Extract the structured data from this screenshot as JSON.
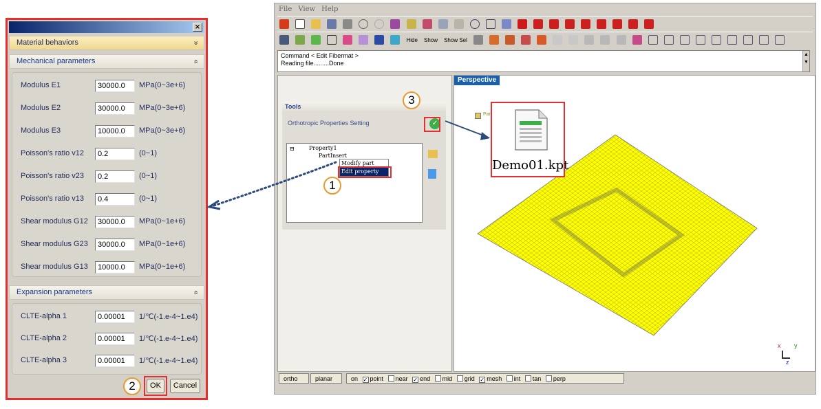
{
  "dialog": {
    "material_header": "Material behaviors",
    "mechanical_header": "Mechanical parameters",
    "expansion_header": "Expansion parameters",
    "close_glyph": "×",
    "chevron_double_down": "»",
    "chevron_double_up": "«",
    "mechanical": [
      {
        "label": "Modulus E1",
        "value": "30000.0",
        "unit": "MPa(0~3e+6)"
      },
      {
        "label": "Modulus E2",
        "value": "30000.0",
        "unit": "MPa(0~3e+6)"
      },
      {
        "label": "Modulus E3",
        "value": "10000.0",
        "unit": "MPa(0~3e+6)"
      },
      {
        "label": "Poisson's ratio v12",
        "value": "0.2",
        "unit": "(0~1)"
      },
      {
        "label": "Poisson's ratio v23",
        "value": "0.2",
        "unit": "(0~1)"
      },
      {
        "label": "Poisson's ratio v13",
        "value": "0.4",
        "unit": "(0~1)"
      },
      {
        "label": "Shear modulus G12",
        "value": "30000.0",
        "unit": "MPa(0~1e+6)"
      },
      {
        "label": "Shear modulus G23",
        "value": "30000.0",
        "unit": "MPa(0~1e+6)"
      },
      {
        "label": "Shear modulus G13",
        "value": "10000.0",
        "unit": "MPa(0~1e+6)"
      }
    ],
    "expansion": [
      {
        "label": "CLTE-alpha 1",
        "value": "0.00001",
        "unit": "1/℃(-1.e-4~1.e4)"
      },
      {
        "label": "CLTE-alpha 2",
        "value": "0.00001",
        "unit": "1/℃(-1.e-4~1.e4)"
      },
      {
        "label": "CLTE-alpha 3",
        "value": "0.00001",
        "unit": "1/℃(-1.e-4~1.e4)"
      }
    ],
    "ok_label": "OK",
    "cancel_label": "Cancel"
  },
  "badges": {
    "one": "1",
    "two": "2",
    "three": "3"
  },
  "app": {
    "menu": [
      "File",
      "View",
      "Help"
    ],
    "toolbar_text": {
      "hide": "Hide",
      "show": "Show",
      "show_sel": "Show Sel"
    },
    "command_lines": [
      "Command < Edit Fibermat >",
      "Reading file.........Done"
    ],
    "tools_title": "Tools",
    "tools_label": "Orthotropic Properties Setting",
    "tree_root": "Property1",
    "tree_child": "PartInsert",
    "context_menu": [
      "Modify part insert",
      "Edit property"
    ],
    "viewport_tab": "Perspective",
    "legend_text": "Par",
    "document_name": "Demo01.kpt",
    "status": {
      "ortho": "ortho",
      "planar": "planar",
      "on": "on",
      "checks": [
        {
          "label": "point",
          "checked": true
        },
        {
          "label": "near",
          "checked": false
        },
        {
          "label": "end",
          "checked": true
        },
        {
          "label": "mid",
          "checked": false
        },
        {
          "label": "grid",
          "checked": false
        },
        {
          "label": "mesh",
          "checked": true
        },
        {
          "label": "int",
          "checked": false
        },
        {
          "label": "tan",
          "checked": false
        },
        {
          "label": "perp",
          "checked": false
        }
      ]
    },
    "axis_labels": {
      "x": "x",
      "y": "y",
      "z": "z"
    }
  },
  "colors": {
    "highlight": "#e03030",
    "badge_border": "#e89a30",
    "mesh": "#ffff00",
    "tab_blue": "#1b5fa8"
  }
}
